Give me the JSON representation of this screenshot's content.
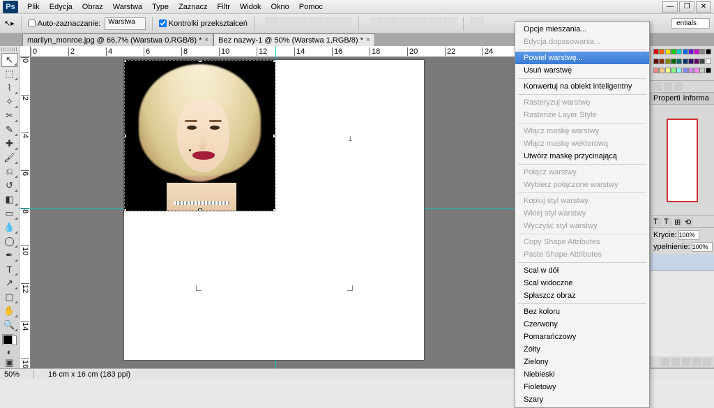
{
  "app": {
    "logo": "Ps"
  },
  "menu": [
    "Plik",
    "Edycja",
    "Obraz",
    "Warstwa",
    "Type",
    "Zaznacz",
    "Filtr",
    "Widok",
    "Okno",
    "Pomoc"
  ],
  "window_controls": {
    "min": "—",
    "max": "❐",
    "close": "✕"
  },
  "options": {
    "auto_select_label": "Auto-zaznaczanie:",
    "auto_select_mode": "Warstwa",
    "show_transform_label": "Kontrolki przekształceń"
  },
  "workspace_switcher": "entials",
  "tabs": [
    {
      "label": "marilyn_monroe.jpg @ 66,7% (Warstwa 0,RGB/8) *",
      "active": false
    },
    {
      "label": "Bez nazwy-1 @ 50% (Warstwa 1,RGB/8) *",
      "active": true
    }
  ],
  "ruler_h": [
    "0",
    "2",
    "4",
    "6",
    "8",
    "10",
    "12",
    "14",
    "16",
    "18",
    "20",
    "22",
    "24"
  ],
  "ruler_v": [
    "0",
    "2",
    "4",
    "6",
    "8",
    "10",
    "12",
    "14",
    "16"
  ],
  "artboard_placeholder_number": "1",
  "context_menu": [
    {
      "label": "Opcje mieszania...",
      "type": "item"
    },
    {
      "label": "Edycja dopasowania...",
      "type": "disabled"
    },
    {
      "type": "sep"
    },
    {
      "label": "Powiel warstwę...",
      "type": "highlighted"
    },
    {
      "label": "Usuń warstwę",
      "type": "item"
    },
    {
      "type": "sep"
    },
    {
      "label": "Konwertuj na obiekt inteligentny",
      "type": "item"
    },
    {
      "type": "sep"
    },
    {
      "label": "Rasteryzuj warstwę",
      "type": "disabled"
    },
    {
      "label": "Rasterize Layer Style",
      "type": "disabled"
    },
    {
      "type": "sep"
    },
    {
      "label": "Włącz maskę warstwy",
      "type": "disabled"
    },
    {
      "label": "Włącz maskę wektorową",
      "type": "disabled"
    },
    {
      "label": "Utwórz maskę przycinającą",
      "type": "item"
    },
    {
      "type": "sep"
    },
    {
      "label": "Połącz warstwy",
      "type": "disabled"
    },
    {
      "label": "Wybierz połączone warstwy",
      "type": "disabled"
    },
    {
      "type": "sep"
    },
    {
      "label": "Kopiuj styl warstwy",
      "type": "disabled"
    },
    {
      "label": "Wklej styl warstwy",
      "type": "disabled"
    },
    {
      "label": "Wyczyść styl warstwy",
      "type": "disabled"
    },
    {
      "type": "sep"
    },
    {
      "label": "Copy Shape Attributes",
      "type": "disabled"
    },
    {
      "label": "Paste Shape Attributes",
      "type": "disabled"
    },
    {
      "type": "sep"
    },
    {
      "label": "Scal w dół",
      "type": "item"
    },
    {
      "label": "Scal widoczne",
      "type": "item"
    },
    {
      "label": "Spłaszcz obraz",
      "type": "item"
    },
    {
      "type": "sep"
    },
    {
      "label": "Bez koloru",
      "type": "item"
    },
    {
      "label": "Czerwony",
      "type": "item"
    },
    {
      "label": "Pomarańczowy",
      "type": "item"
    },
    {
      "label": "Żółty",
      "type": "item"
    },
    {
      "label": "Zielony",
      "type": "item"
    },
    {
      "label": "Niebieski",
      "type": "item"
    },
    {
      "label": "Fioletowy",
      "type": "item"
    },
    {
      "label": "Szary",
      "type": "item"
    }
  ],
  "panels": {
    "tabs1": [
      "Properti",
      "Informa"
    ],
    "opacity_label": "Krycie:",
    "opacity_value": "100%",
    "fill_label": "ypełnienie:",
    "fill_value": "100%"
  },
  "swatch_colors": [
    "#d00",
    "#e60",
    "#ed0",
    "#0c0",
    "#0cc",
    "#06e",
    "#60e",
    "#c0c",
    "#888",
    "#000",
    "#600",
    "#830",
    "#880",
    "#060",
    "#066",
    "#036",
    "#306",
    "#606",
    "#444",
    "#fff",
    "#f88",
    "#fc8",
    "#ff8",
    "#8f8",
    "#8ff",
    "#88f",
    "#c8f",
    "#f8f",
    "#ccc",
    "#000"
  ],
  "status": {
    "zoom": "50%",
    "dims": "16 cm x 16 cm (183 ppi)"
  },
  "tools": [
    {
      "name": "move-tool",
      "glyph": "↖",
      "active": true
    },
    {
      "name": "marquee-tool",
      "glyph": "⬚"
    },
    {
      "name": "lasso-tool",
      "glyph": "⌇"
    },
    {
      "name": "magic-wand-tool",
      "glyph": "✧"
    },
    {
      "name": "crop-tool",
      "glyph": "✂"
    },
    {
      "name": "eyedropper-tool",
      "glyph": "✎"
    },
    {
      "name": "healing-brush-tool",
      "glyph": "✚"
    },
    {
      "name": "brush-tool",
      "glyph": "🖌"
    },
    {
      "name": "clone-stamp-tool",
      "glyph": "⎌"
    },
    {
      "name": "history-brush-tool",
      "glyph": "↺"
    },
    {
      "name": "eraser-tool",
      "glyph": "◧"
    },
    {
      "name": "gradient-tool",
      "glyph": "▭"
    },
    {
      "name": "blur-tool",
      "glyph": "💧"
    },
    {
      "name": "dodge-tool",
      "glyph": "◯"
    },
    {
      "name": "pen-tool",
      "glyph": "✒"
    },
    {
      "name": "type-tool",
      "glyph": "T"
    },
    {
      "name": "path-selection-tool",
      "glyph": "↗"
    },
    {
      "name": "rectangle-tool",
      "glyph": "▢"
    },
    {
      "name": "hand-tool",
      "glyph": "✋"
    },
    {
      "name": "zoom-tool",
      "glyph": "🔍"
    }
  ]
}
